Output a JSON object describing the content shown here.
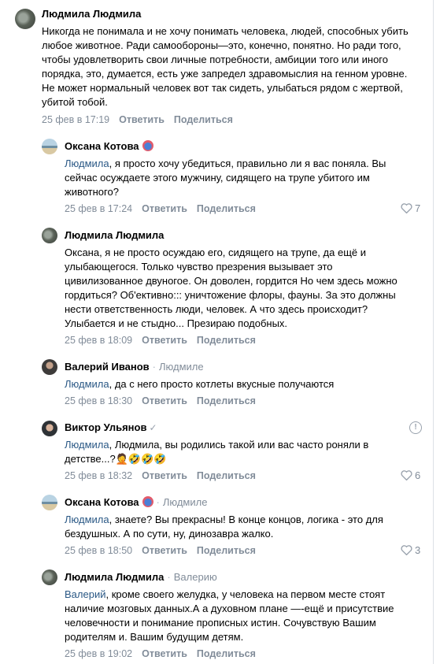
{
  "comments": [
    {
      "author": "Людмила Людмила",
      "text": "Никогда не понимала и не хочу понимать человека, людей, способных убить любое животное. Ради самообороны—это, конечно, понятно. Но ради того, чтобы удовлетворить свои личные потребности, амбиции того или иного порядка, это, думается, есть уже запредел здравомыслия на генном уровне. Не может нормальный человек вот так сидеть, улыбаться рядом с жертвой, убитой тобой.",
      "date": "25 фев в 17:19",
      "reply_label": "Ответить",
      "share_label": "Поделиться"
    },
    {
      "author": "Оксана Котова",
      "mention": "Людмила",
      "text": ", я просто хочу убедиться, правильно ли я вас поняла. Вы сейчас осуждаете этого мужчину, сидящего на трупе убитого им животного?",
      "date": "25 фев в 17:24",
      "reply_label": "Ответить",
      "share_label": "Поделиться",
      "likes": "7"
    },
    {
      "author": "Людмила Людмила",
      "text": "Оксана, я не просто осуждаю его, сидящего на трупе, да ещё и улыбающегося. Только чувство презрения вызывает это цивилизованное двуногое. Он доволен, гордится Но чем здесь можно гордиться? Об'ективно::: уничтожение флоры, фауны. За это должны нести ответственность люди, человек. А что здесь происходит? Улыбается и не стыдно... Презираю подобных.",
      "date": "25 фев в 18:09",
      "reply_label": "Ответить",
      "share_label": "Поделиться"
    },
    {
      "author": "Валерий Иванов",
      "reply_to": "Людмиле",
      "mention": "Людмила",
      "text": ", да с него просто котлеты вкусные получаются",
      "date": "25 фев в 18:30",
      "reply_label": "Ответить",
      "share_label": "Поделиться"
    },
    {
      "author": "Виктор Ульянов",
      "mention": "Людмила",
      "text": ", Людмила, вы родились такой или вас часто роняли в детстве...?",
      "emojis": "🤦🤣🤣🤣",
      "date": "25 фев в 18:32",
      "reply_label": "Ответить",
      "share_label": "Поделиться",
      "likes": "6"
    },
    {
      "author": "Оксана Котова",
      "reply_to": "Людмиле",
      "mention": "Людмила",
      "text": ", знаете? Вы прекрасны! В конце концов, логика - это для бездушных. А по сути, ну, динозавра жалко.",
      "date": "25 фев в 18:50",
      "reply_label": "Ответить",
      "share_label": "Поделиться",
      "likes": "3"
    },
    {
      "author": "Людмила Людмила",
      "reply_to": "Валерию",
      "mention": "Валерий",
      "text": ", кроме своего желудка, у человека на первом месте стоят наличие мозговых данных.А а духовном плане —-ещё и присутствие человечности и понимание прописных истин. Сочувствую Вашим родителям и. Вашим будущим детям.",
      "date": "25 фев в 19:02",
      "reply_label": "Ответить",
      "share_label": "Поделиться"
    }
  ]
}
